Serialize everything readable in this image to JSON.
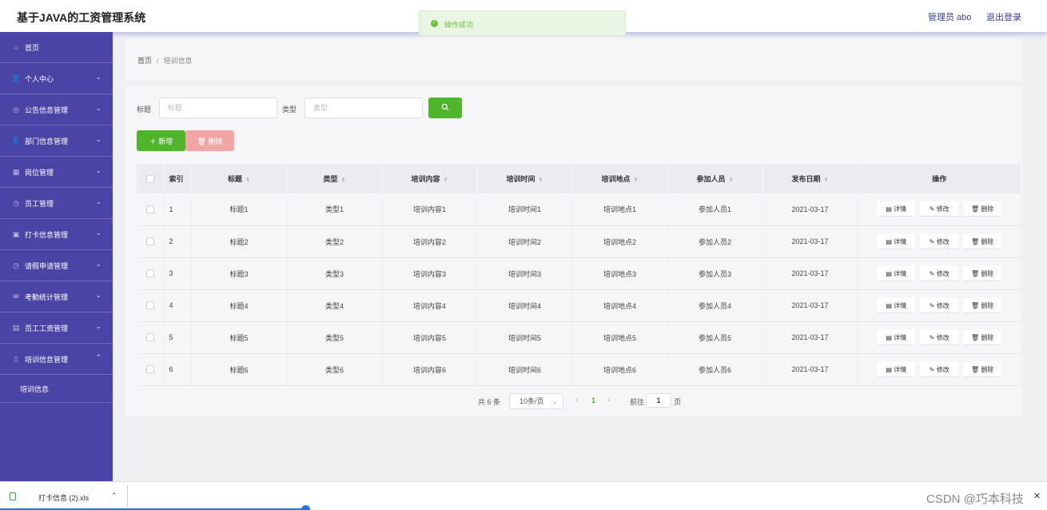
{
  "header": {
    "title": "基于JAVA的工资管理系统",
    "user": "管理员 abo",
    "logout": "退出登录"
  },
  "toast": {
    "message": "操作成功",
    "icon": "check-circle-icon",
    "color": "#67c23a"
  },
  "sidebar": {
    "items": [
      {
        "label": "首页",
        "icon": "home-icon",
        "glyph": "⌂"
      },
      {
        "label": "个人中心",
        "icon": "person-icon",
        "glyph": "👤"
      },
      {
        "label": "公告信息管理",
        "icon": "notice-icon",
        "glyph": "◎"
      },
      {
        "label": "部门信息管理",
        "icon": "person-icon",
        "glyph": "👤"
      },
      {
        "label": "岗位管理",
        "icon": "grid-icon",
        "glyph": "▦"
      },
      {
        "label": "员工管理",
        "icon": "compass-icon",
        "glyph": "◷"
      },
      {
        "label": "打卡信息管理",
        "icon": "badge-icon",
        "glyph": "▣"
      },
      {
        "label": "请假申请管理",
        "icon": "clock-icon",
        "glyph": "◷"
      },
      {
        "label": "考勤统计管理",
        "icon": "mail-icon",
        "glyph": "✉"
      },
      {
        "label": "员工工资管理",
        "icon": "chart-icon",
        "glyph": "▤"
      },
      {
        "label": "培训信息管理",
        "icon": "phone-icon",
        "glyph": "▯"
      }
    ],
    "submenu_label": "培训信息",
    "bg": "#4a44a6"
  },
  "breadcrumb": {
    "home": "首页",
    "sep": "/",
    "current": "培训信息"
  },
  "search": {
    "title_label": "标题",
    "title_placeholder": "标题",
    "type_label": "类型",
    "type_placeholder": "类型",
    "button_icon": "search-icon"
  },
  "actions": {
    "add": "＋ 新增",
    "delete": "🗑 删除"
  },
  "table": {
    "headers": [
      "索引",
      "标题",
      "类型",
      "培训内容",
      "培训时间",
      "培训地点",
      "参加人员",
      "发布日期",
      "操作"
    ],
    "rows": [
      [
        "1",
        "标题1",
        "类型1",
        "培训内容1",
        "培训时间1",
        "培训地点1",
        "参加人员1",
        "2021-03-17"
      ],
      [
        "2",
        "标题2",
        "类型2",
        "培训内容2",
        "培训时间2",
        "培训地点2",
        "参加人员2",
        "2021-03-17"
      ],
      [
        "3",
        "标题3",
        "类型3",
        "培训内容3",
        "培训时间3",
        "培训地点3",
        "参加人员3",
        "2021-03-17"
      ],
      [
        "4",
        "标题4",
        "类型4",
        "培训内容4",
        "培训时间4",
        "培训地点4",
        "参加人员4",
        "2021-03-17"
      ],
      [
        "5",
        "标题5",
        "类型5",
        "培训内容5",
        "培训时间5",
        "培训地点5",
        "参加人员5",
        "2021-03-17"
      ],
      [
        "6",
        "标题6",
        "类型6",
        "培训内容6",
        "培训时间6",
        "培训地点6",
        "参加人员6",
        "2021-03-17"
      ]
    ],
    "row_actions": {
      "detail": "详情",
      "edit": "修改",
      "delete": "删除"
    }
  },
  "pagination": {
    "total": "共 6 条",
    "page_size": "10条/页",
    "current_page": "1",
    "goto": "前往",
    "goto_value": "1",
    "page_suffix": "页"
  },
  "download": {
    "filename": "打卡信息 (2).xls"
  },
  "watermark": "CSDN @巧本科技"
}
